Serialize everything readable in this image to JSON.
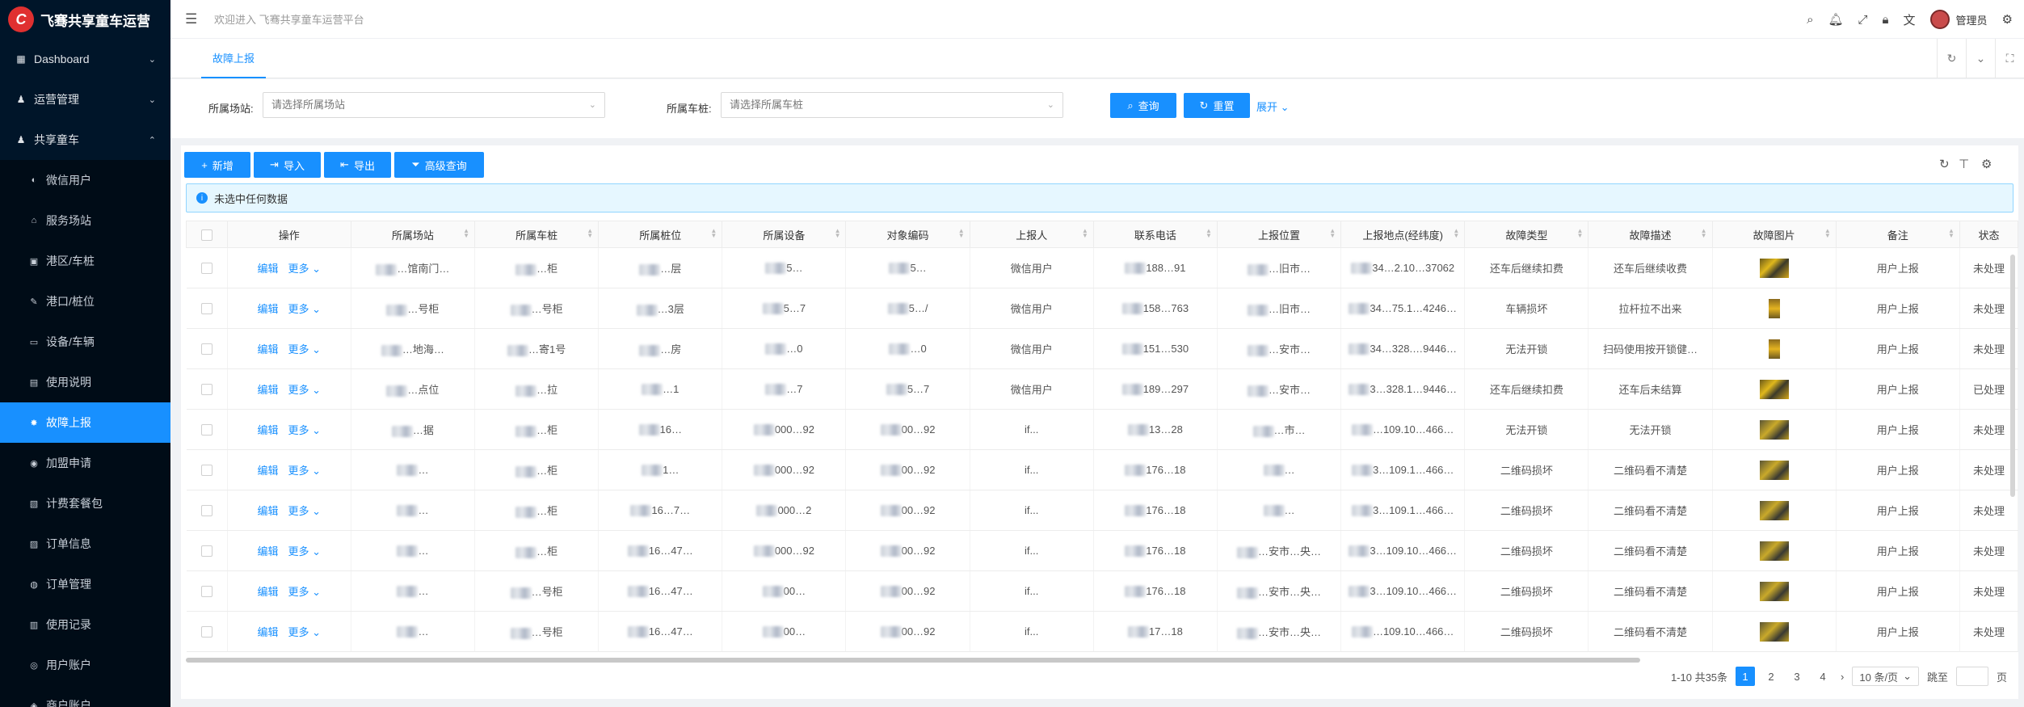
{
  "app": {
    "title": "飞骞共享童车运营",
    "welcome": "欢迎进入 飞骞共享童车运营平台",
    "user": "管理员",
    "logo_glyph": "C"
  },
  "sidebar": {
    "groups": [
      {
        "label": "Dashboard",
        "icon": "dashboard-icon",
        "chev": "⌄"
      },
      {
        "label": "运营管理",
        "icon": "user-icon",
        "chev": "⌄"
      },
      {
        "label": "共享童车",
        "icon": "user-icon",
        "chev": "⌃"
      }
    ],
    "items": [
      {
        "label": "微信用户",
        "icon": "wechat-icon"
      },
      {
        "label": "服务场站",
        "icon": "bank-icon"
      },
      {
        "label": "港区/车桩",
        "icon": "building-icon"
      },
      {
        "label": "港口/桩位",
        "icon": "wrench-icon"
      },
      {
        "label": "设备/车辆",
        "icon": "car-icon"
      },
      {
        "label": "使用说明",
        "icon": "file-icon"
      },
      {
        "label": "故障上报",
        "icon": "bug-icon",
        "active": true
      },
      {
        "label": "加盟申请",
        "icon": "apply-icon"
      },
      {
        "label": "计费套餐包",
        "icon": "fee-icon"
      },
      {
        "label": "订单信息",
        "icon": "order-icon"
      },
      {
        "label": "订单管理",
        "icon": "order-manage-icon"
      },
      {
        "label": "使用记录",
        "icon": "record-icon"
      },
      {
        "label": "用户账户",
        "icon": "account-icon"
      },
      {
        "label": "商户账户",
        "icon": "merchant-icon"
      }
    ]
  },
  "tabs": {
    "active": "故障上报"
  },
  "search": {
    "station_label": "所属场站:",
    "station_placeholder": "请选择所属场站",
    "pile_label": "所属车桩:",
    "pile_placeholder": "请选择所属车桩",
    "query": "查询",
    "reset": "重置",
    "expand": "展开"
  },
  "toolbar": {
    "add": "新增",
    "import": "导入",
    "export": "导出",
    "advanced": "高级查询"
  },
  "alert": "未选中任何数据",
  "table": {
    "columns": [
      "操作",
      "所属场站",
      "所属车桩",
      "所属桩位",
      "所属设备",
      "对象编码",
      "上报人",
      "联系电话",
      "上报位置",
      "上报地点(经纬度)",
      "故障类型",
      "故障描述",
      "故障图片",
      "备注",
      "状态"
    ],
    "edit": "编辑",
    "more": "更多",
    "rows": [
      {
        "station": "…馆南门…",
        "pile": "…柜",
        "pos": "…层",
        "dev": "5…",
        "code": "5…",
        "reporter": "微信用户",
        "phone": "188…91",
        "loc": "…旧市…",
        "geo": "34…2.10…37062",
        "type": "还车后继续扣费",
        "desc": "还车后继续收费",
        "remark": "用户上报",
        "status": "未处理",
        "img": "wide"
      },
      {
        "station": "…号柜",
        "pile": "…号柜",
        "pos": "…3层",
        "dev": "5…7",
        "code": "5…/",
        "reporter": "微信用户",
        "phone": "158…763",
        "loc": "…旧市…",
        "geo": "34…75.1…4246…",
        "type": "车辆损坏",
        "desc": "拉杆拉不出来",
        "remark": "用户上报",
        "status": "未处理",
        "img": "tall"
      },
      {
        "station": "…地海…",
        "pile": "…寄1号",
        "pos": "…房",
        "dev": "…0",
        "code": "…0",
        "reporter": "微信用户",
        "phone": "151…530",
        "loc": "…安市…",
        "geo": "34…328.…9446…",
        "type": "无法开锁",
        "desc": "扫码使用按开锁健…",
        "remark": "用户上报",
        "status": "未处理",
        "img": "tall"
      },
      {
        "station": "…点位",
        "pile": "…拉",
        "pos": "…1",
        "dev": "…7",
        "code": "5…7",
        "reporter": "微信用户",
        "phone": "189…297",
        "loc": "…安市…",
        "geo": "3…328.1…9446…",
        "type": "还车后继续扣费",
        "desc": "还车后未结算",
        "remark": "用户上报",
        "status": "已处理",
        "img": "wide"
      },
      {
        "station": "…据",
        "pile": "…柜",
        "pos": "16…",
        "dev": "000…92",
        "code": "00…92",
        "reporter": "if...",
        "phone": "13…28",
        "loc": "…市…",
        "geo": "…109.10…466…",
        "type": "无法开锁",
        "desc": "无法开锁",
        "remark": "用户上报",
        "status": "未处理",
        "img": "c"
      },
      {
        "station": "…",
        "pile": "…柜",
        "pos": "1…",
        "dev": "000…92",
        "code": "00…92",
        "reporter": "if...",
        "phone": "176…18",
        "loc": "…",
        "geo": "3…109.1…466…",
        "type": "二维码损坏",
        "desc": "二维码看不清楚",
        "remark": "用户上报",
        "status": "未处理",
        "img": "c"
      },
      {
        "station": "…",
        "pile": "…柜",
        "pos": "16…7…",
        "dev": "000…2",
        "code": "00…92",
        "reporter": "if...",
        "phone": "176…18",
        "loc": "…",
        "geo": "3…109.1…466…",
        "type": "二维码损坏",
        "desc": "二维码看不清楚",
        "remark": "用户上报",
        "status": "未处理",
        "img": "c"
      },
      {
        "station": "…",
        "pile": "…柜",
        "pos": "16…47…",
        "dev": "000…92",
        "code": "00…92",
        "reporter": "if...",
        "phone": "176…18",
        "loc": "…安市…央…",
        "geo": "3…109.10…466…",
        "type": "二维码损坏",
        "desc": "二维码看不清楚",
        "remark": "用户上报",
        "status": "未处理",
        "img": "c"
      },
      {
        "station": "…",
        "pile": "…号柜",
        "pos": "16…47…",
        "dev": "00…",
        "code": "00…92",
        "reporter": "if...",
        "phone": "176…18",
        "loc": "…安市…央…",
        "geo": "3…109.10…466…",
        "type": "二维码损坏",
        "desc": "二维码看不清楚",
        "remark": "用户上报",
        "status": "未处理",
        "img": "c"
      },
      {
        "station": "…",
        "pile": "…号柜",
        "pos": "16…47…",
        "dev": "00…",
        "code": "00…92",
        "reporter": "if...",
        "phone": "17…18",
        "loc": "…安市…央…",
        "geo": "…109.10…466…",
        "type": "二维码损坏",
        "desc": "二维码看不清楚",
        "remark": "用户上报",
        "status": "未处理",
        "img": "c"
      }
    ]
  },
  "pagination": {
    "summary": "1-10 共35条",
    "pages": [
      "1",
      "2",
      "3",
      "4"
    ],
    "current": "1",
    "size": "10 条/页",
    "jump": "跳至",
    "unit": "页"
  }
}
